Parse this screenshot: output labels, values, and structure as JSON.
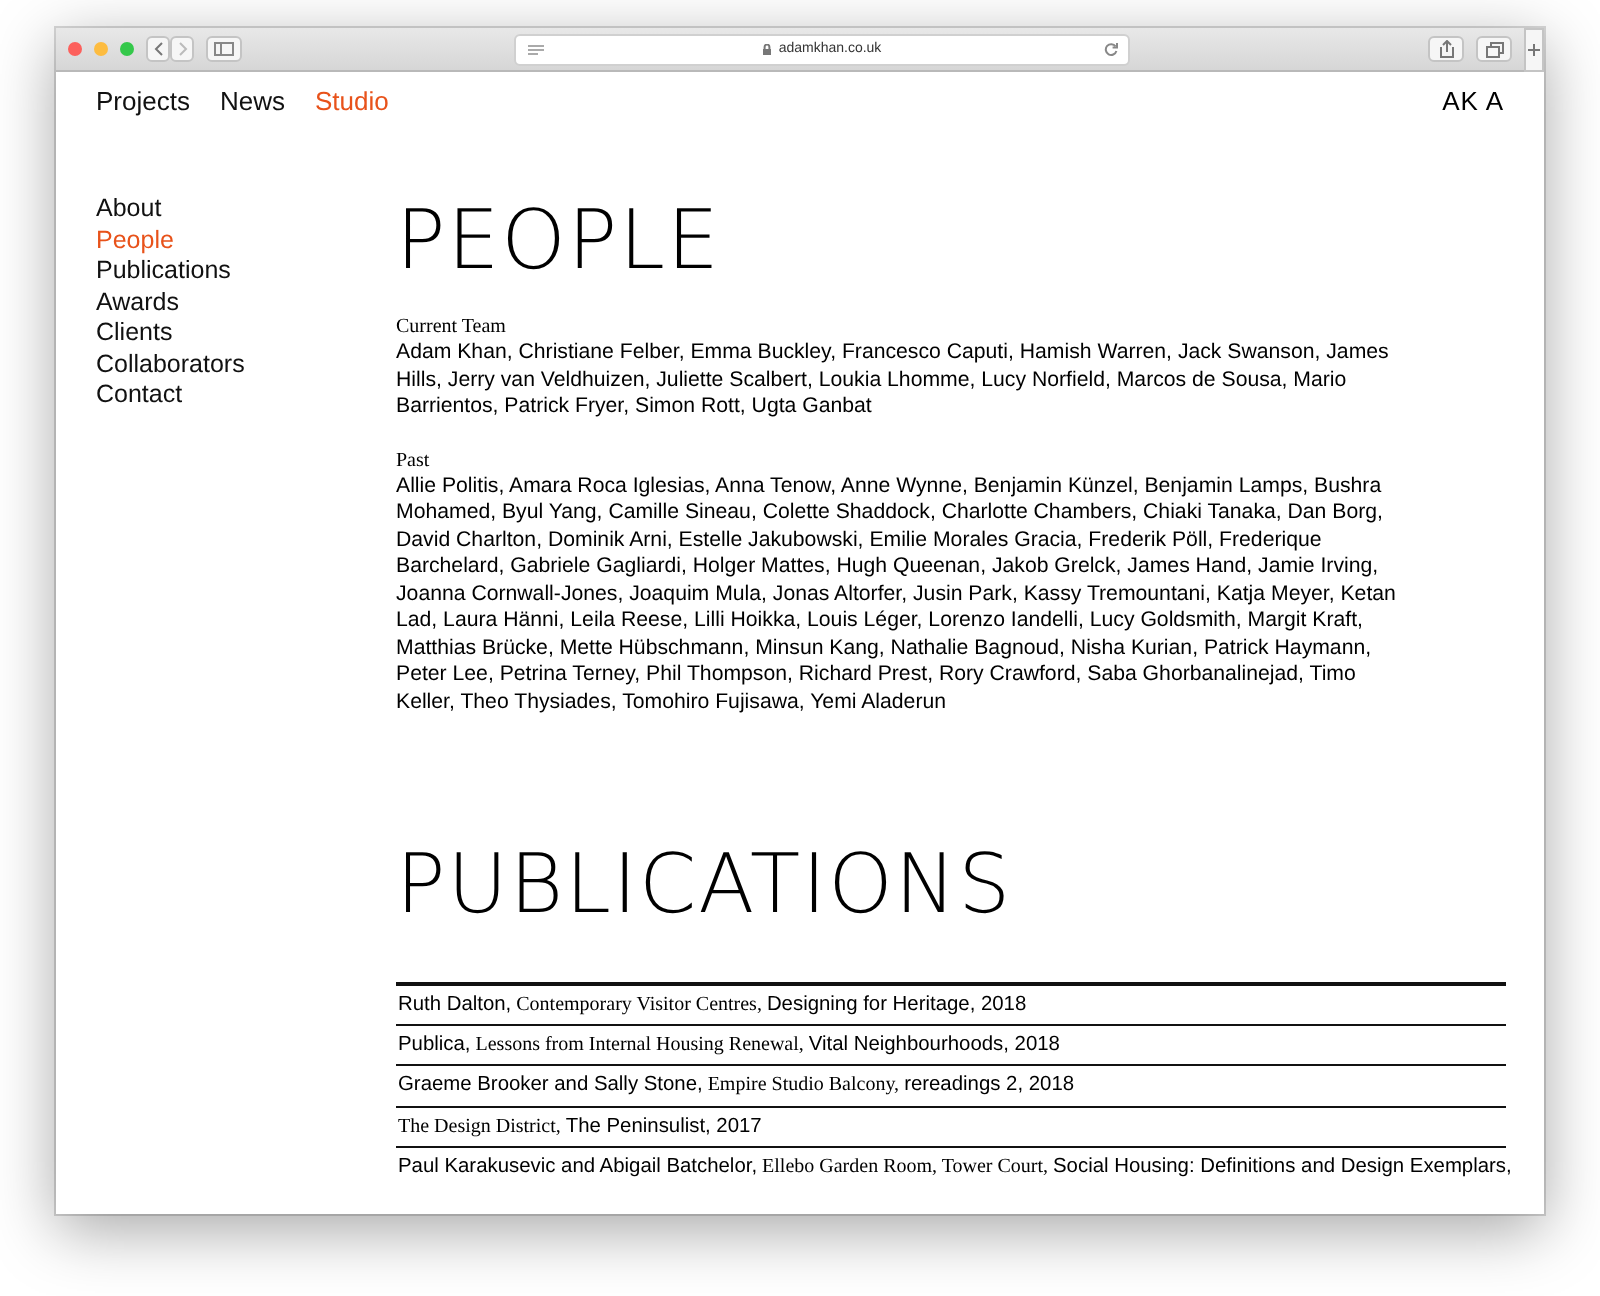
{
  "browser": {
    "url": "adamkhan.co.uk"
  },
  "nav": [
    {
      "label": "Projects",
      "selected": false
    },
    {
      "label": "News",
      "selected": false
    },
    {
      "label": "Studio",
      "selected": true
    }
  ],
  "logo": "AK A",
  "sidebar": {
    "items": [
      {
        "label": "About",
        "selected": false
      },
      {
        "label": "People",
        "selected": true
      },
      {
        "label": "Publications",
        "selected": false
      },
      {
        "label": "Awards",
        "selected": false
      },
      {
        "label": "Clients",
        "selected": false
      },
      {
        "label": "Collaborators",
        "selected": false
      },
      {
        "label": "Contact",
        "selected": false
      }
    ]
  },
  "people": {
    "heading": "PEOPLE",
    "groups": [
      {
        "title": "Current Team",
        "names": "Adam Khan, Christiane Felber, Emma Buckley, Francesco Caputi, Hamish Warren, Jack Swanson, James Hills, Jerry van Veldhuizen, Juliette Scalbert, Loukia Lhomme, Lucy Norfield, Marcos de Sousa, Mario Barrientos, Patrick Fryer, Simon Rott, Ugta Ganbat"
      },
      {
        "title": "Past",
        "names": "Allie Politis, Amara Roca Iglesias, Anna Tenow, Anne Wynne, Benjamin Künzel, Benjamin Lamps, Bushra Mohamed, Byul Yang, Camille Sineau, Colette Shaddock, Charlotte Chambers, Chiaki Tanaka, Dan Borg, David Charlton, Dominik Arni, Estelle Jakubowski, Emilie Morales Gracia, Frederik Pöll, Frederique Barchelard, Gabriele Gagliardi, Holger Mattes, Hugh Queenan, Jakob Grelck, James Hand, Jamie Irving, Joanna Cornwall-Jones, Joaquim Mula, Jonas Altorfer, Jusin Park, Kassy Tremountani, Katja Meyer, Ketan Lad, Laura Hänni, Leila Reese, Lilli Hoikka, Louis Léger, Lorenzo Iandelli, Lucy Goldsmith, Margit Kraft, Matthias Brücke, Mette Hübschmann, Minsun Kang, Nathalie Bagnoud, Nisha Kurian, Patrick Haymann, Peter Lee, Petrina Terney, Phil Thompson, Richard Prest, Rory Crawford, Saba Ghorbanalinejad, Timo Keller, Theo Thysiades, Tomohiro Fujisawa, Yemi Aladerun"
      }
    ]
  },
  "publications": {
    "heading": "PUBLICATIONS",
    "rows": [
      [
        {
          "kind": "text",
          "text": "Ruth Dalton,"
        },
        {
          "kind": "title",
          "text": "Contemporary Visitor Centres,"
        },
        {
          "kind": "text",
          "text": "Designing for Heritage, 2018"
        }
      ],
      [
        {
          "kind": "text",
          "text": "Publica,"
        },
        {
          "kind": "title",
          "text": "Lessons from Internal Housing Renewal,"
        },
        {
          "kind": "text",
          "text": "Vital Neighbourhoods, 2018"
        }
      ],
      [
        {
          "kind": "text",
          "text": "Graeme Brooker and Sally Stone,"
        },
        {
          "kind": "title",
          "text": "Empire Studio Balcony,"
        },
        {
          "kind": "text",
          "text": "rereadings 2, 2018"
        }
      ],
      [
        {
          "kind": "title",
          "text": "The Design District,"
        },
        {
          "kind": "text",
          "text": "The Peninsulist, 2017"
        }
      ],
      [
        {
          "kind": "text",
          "text": "Paul Karakusevic and Abigail Batchelor,"
        },
        {
          "kind": "title",
          "text": "Ellebo Garden Room, Tower Court,"
        },
        {
          "kind": "text",
          "text": "Social Housing: Definitions and Design Exemplars,"
        }
      ]
    ]
  }
}
